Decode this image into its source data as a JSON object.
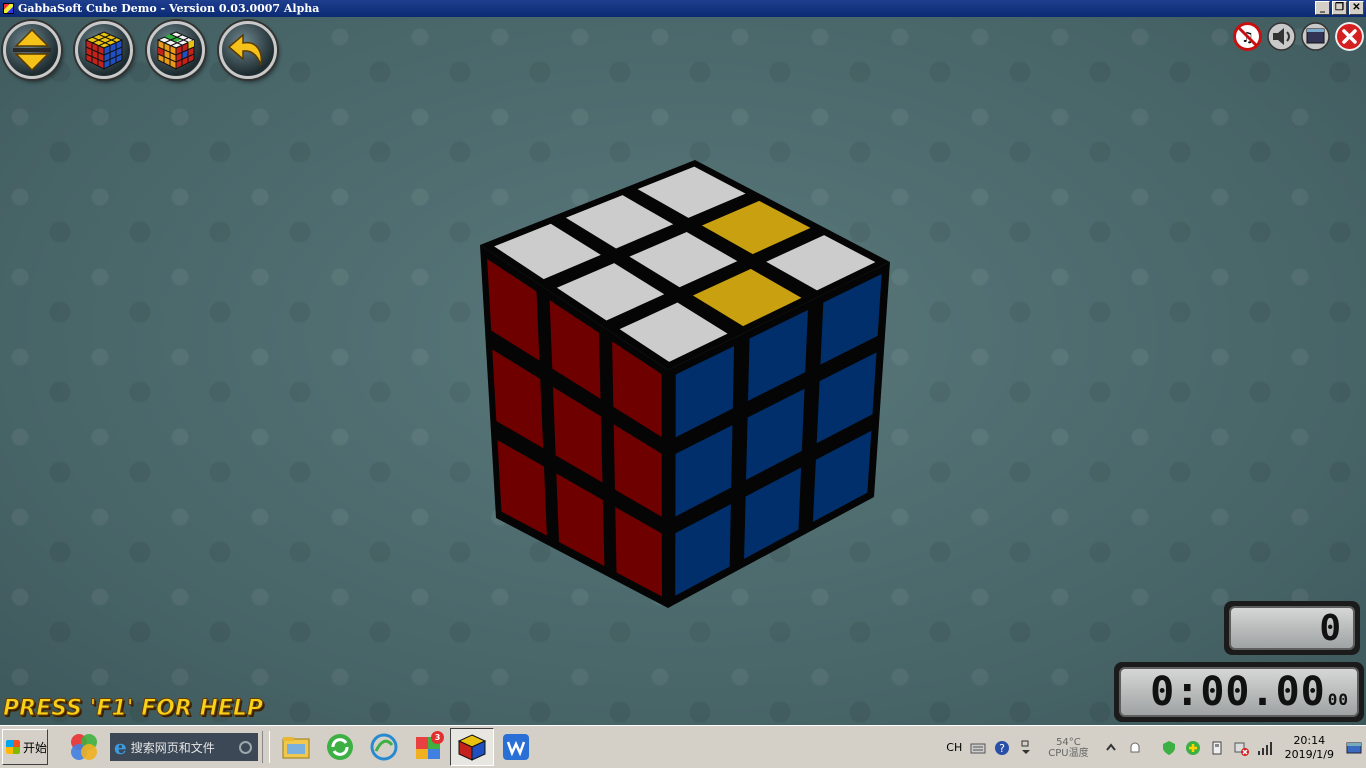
{
  "window": {
    "title": "GabbaSoft Cube Demo - Version 0.03.0007 Alpha",
    "minimize_label": "_",
    "restore_label": "❐",
    "close_label": "✕"
  },
  "toolbar": {
    "buttons": [
      {
        "name": "scramble-arrows-button",
        "icon": "up-down-arrows-icon"
      },
      {
        "name": "solve-cube-button",
        "icon": "solved-cube-icon"
      },
      {
        "name": "scrambled-cube-button",
        "icon": "scrambled-cube-icon"
      },
      {
        "name": "undo-button",
        "icon": "undo-arrow-icon"
      }
    ]
  },
  "system_buttons": [
    {
      "name": "no-music-button",
      "icon": "no-music-icon"
    },
    {
      "name": "sound-button",
      "icon": "speaker-icon"
    },
    {
      "name": "window-mode-button",
      "icon": "window-icon"
    },
    {
      "name": "exit-button",
      "icon": "close-icon"
    }
  ],
  "cube": {
    "top_colors": [
      "#cccccc",
      "#cccccc",
      "#cccccc",
      "#cccccc",
      "#cccccc",
      "#c9a010",
      "#cccccc",
      "#c9a010",
      "#cccccc"
    ],
    "left_color": "#6e0000",
    "right_color": "#002f6b"
  },
  "counter": {
    "moves": "0"
  },
  "timer": {
    "main": "0:00.00",
    "fraction": "00"
  },
  "help": {
    "text": "PRESS 'F1' FOR HELP"
  },
  "taskbar": {
    "start_label": "开始",
    "search_placeholder": "搜索网页和文件",
    "badge_count": "3",
    "tray": {
      "lang": "CH",
      "temp_value": "54°C",
      "temp_label": "CPU温度",
      "time": "20:14",
      "date": "2019/1/9"
    }
  }
}
